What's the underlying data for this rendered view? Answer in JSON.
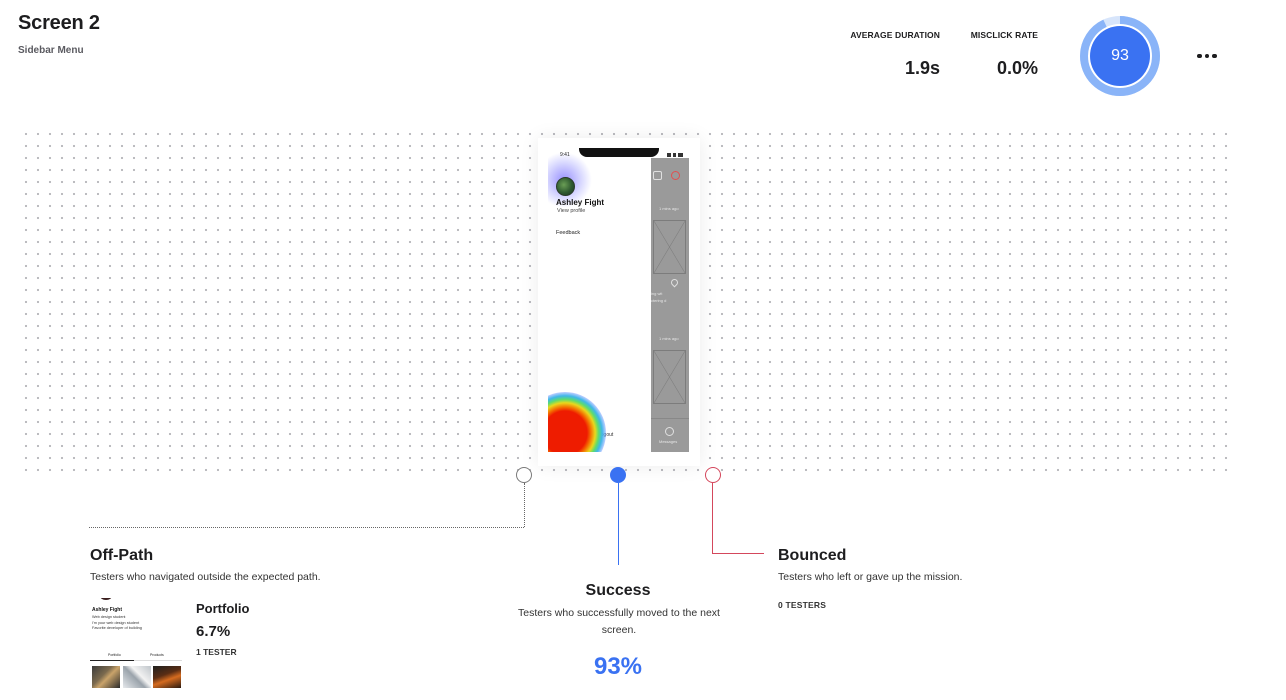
{
  "header": {
    "title": "Screen 2",
    "subtitle": "Sidebar Menu"
  },
  "metrics": {
    "average_duration": {
      "label": "AVERAGE DURATION",
      "value": "1.9s"
    },
    "misclick_rate": {
      "label": "MISCLICK RATE",
      "value": "0.0%"
    }
  },
  "score": {
    "value": "93",
    "fraction": 0.93,
    "ring_color": "#8ab4f8",
    "center_color": "#3a72f2"
  },
  "actions": {
    "more_icon": "more-horizontal-icon"
  },
  "phone_preview": {
    "status_time": "9:41",
    "profile_name": "Ashley Fight",
    "profile_link": "View profile",
    "menu_item": "Feedback",
    "bottom_item": "Logout",
    "behind_labels": [
      "1 mins ago",
      "ing wit",
      "ctering d",
      "1 mins ago",
      "Messages"
    ],
    "heatmap_colors": [
      "#ee1c00",
      "#f46a00",
      "#e9d81c",
      "#5ddc6e",
      "#3fb7e8",
      "#786eff"
    ]
  },
  "paths": {
    "off_path": {
      "title": "Off-Path",
      "description": "Testers who navigated outside the expected path.",
      "node_color": "#7a7a7a",
      "screens": [
        {
          "name": "Portfolio",
          "percent": "6.7%",
          "count": "1 TESTER",
          "thumbnail": {
            "name": "Ashley Fight",
            "lines": [
              "Web design student",
              "I'm your web design student",
              "Favorite developer of building"
            ],
            "tabs": [
              "Portfolio",
              "Products"
            ]
          }
        }
      ]
    },
    "success": {
      "title": "Success",
      "description": "Testers who successfully moved to the next screen.",
      "percent": "93%",
      "node_color": "#3a72f2"
    },
    "bounced": {
      "title": "Bounced",
      "description": "Testers who left or gave up the mission.",
      "count": "0 TESTERS",
      "node_color": "#d4475c"
    }
  }
}
